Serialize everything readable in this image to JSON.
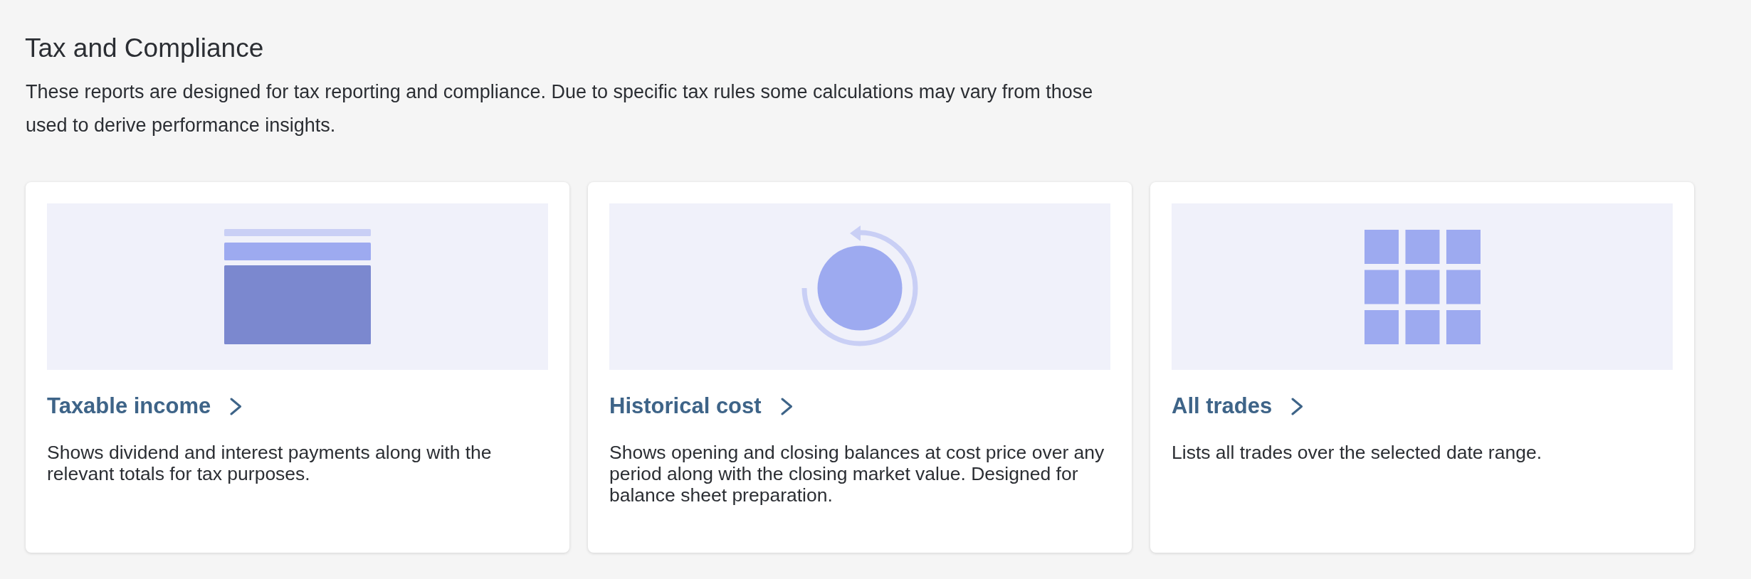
{
  "page": {
    "title": "Tax and Compliance",
    "description": "These reports are designed for tax reporting and compliance. Due to specific tax rules some calculations may vary from those used to derive performance insights."
  },
  "cards": [
    {
      "kind": "layout",
      "title": "Taxable income",
      "description": "Shows dividend and interest payments along with the relevant totals for tax purposes."
    },
    {
      "kind": "history",
      "title": "Historical cost",
      "description": "Shows opening and closing balances at cost price over any period along with the closing market value. Designed for balance sheet preparation."
    },
    {
      "kind": "grid",
      "title": "All trades",
      "description": "Lists all trades over the selected date range."
    }
  ]
}
